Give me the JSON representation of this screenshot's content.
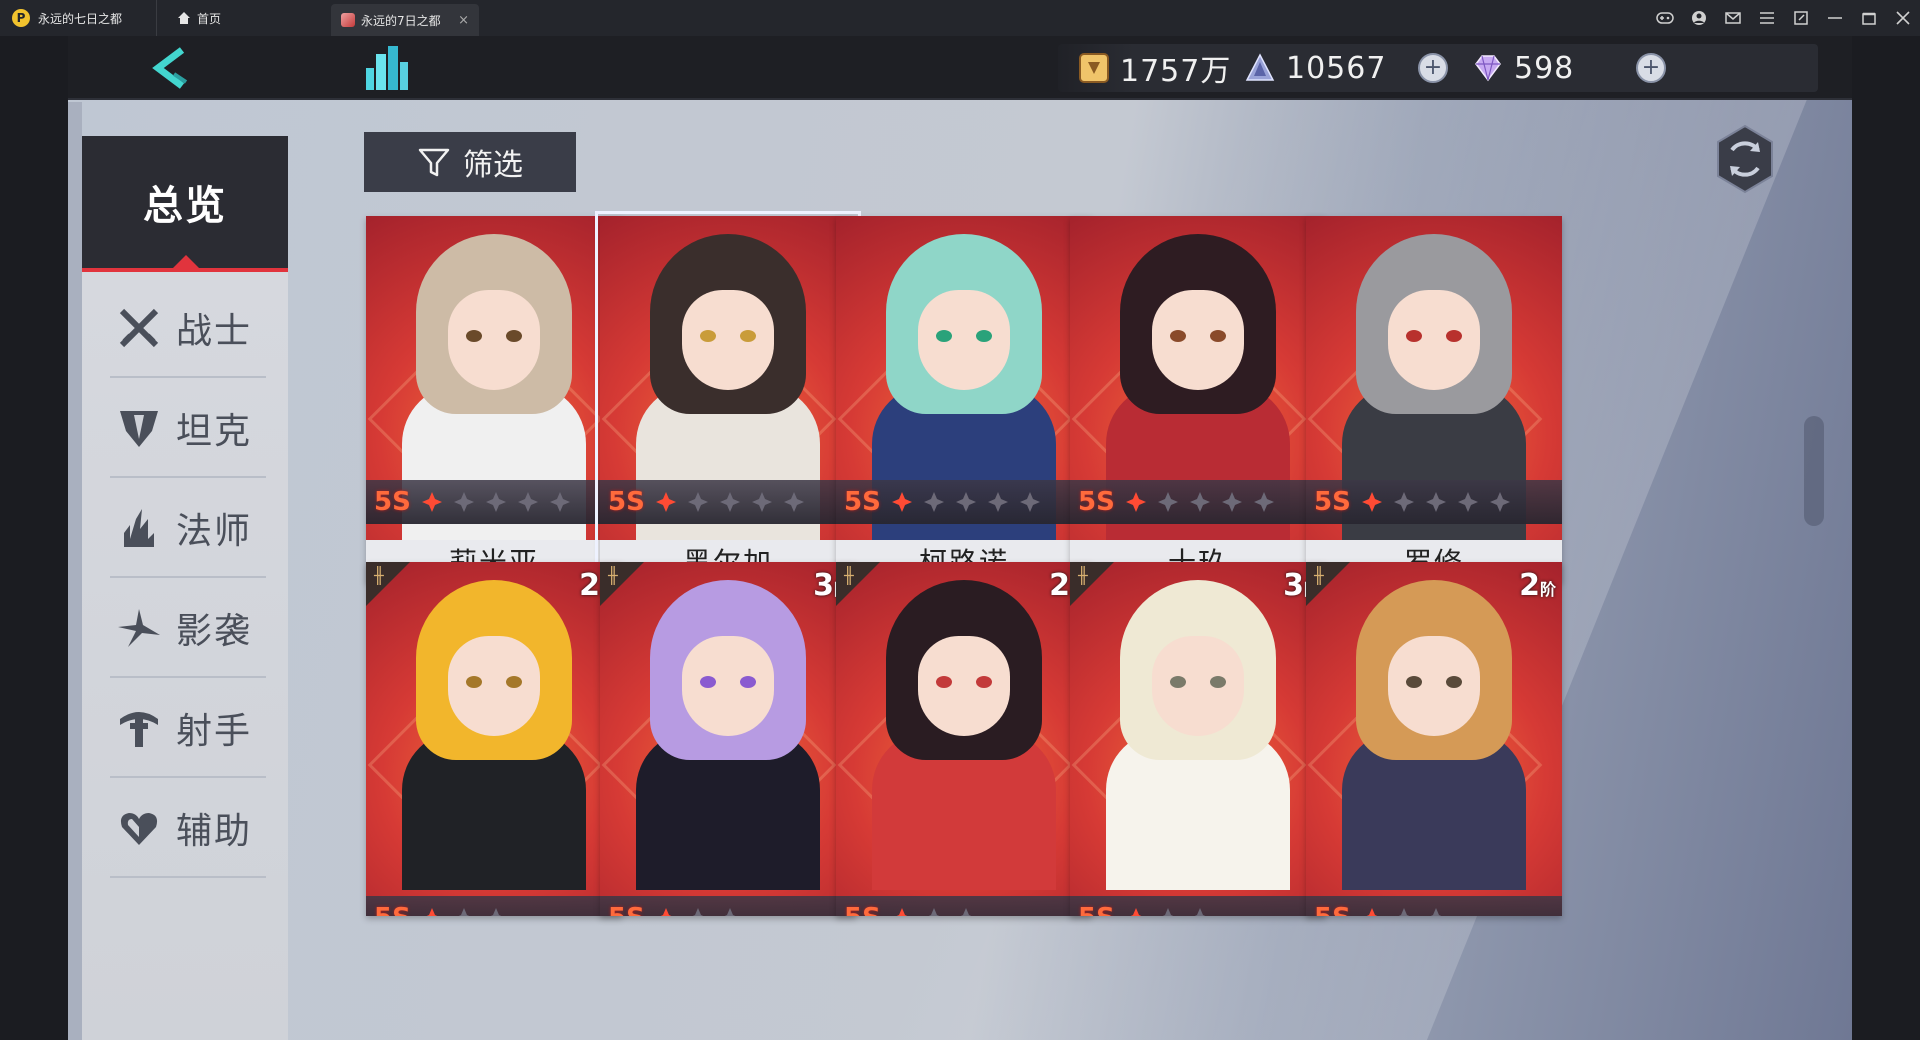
{
  "browser": {
    "app_title": "永远的七日之都",
    "home_tab": "首页",
    "game_tab": "永远的7日之都",
    "tab_close": "×"
  },
  "topbar": {
    "gold": "1757万",
    "crystal": "10567",
    "diamond": "598"
  },
  "sidebar": {
    "overview": "总览",
    "items": [
      {
        "label": "战士",
        "icon": "sword-icon"
      },
      {
        "label": "坦克",
        "icon": "shield-icon"
      },
      {
        "label": "法师",
        "icon": "flame-icon"
      },
      {
        "label": "影袭",
        "icon": "shuriken-icon"
      },
      {
        "label": "射手",
        "icon": "crossbow-icon"
      },
      {
        "label": "辅助",
        "icon": "heart-icon"
      }
    ]
  },
  "filter": {
    "label": "筛选"
  },
  "cards_row1": [
    {
      "name": "莉米亚",
      "rank": "5S",
      "hair": "#cdbba6",
      "body": "#f0f0f0",
      "eye": "#6a4a2a"
    },
    {
      "name": "黑尔加",
      "rank": "5S",
      "hair": "#3a2e2c",
      "body": "#e9e4dd",
      "eye": "#c99c3a"
    },
    {
      "name": "柯路诺",
      "rank": "5S",
      "hair": "#8fd6c8",
      "body": "#2c3f7c",
      "eye": "#2aa27a"
    },
    {
      "name": "十玖",
      "rank": "5S",
      "hair": "#2e1c22",
      "body": "#b92c34",
      "eye": "#8a4a2a"
    },
    {
      "name": "罗修",
      "rank": "5S",
      "hair": "#9a9a9e",
      "body": "#3a3c44",
      "eye": "#b8312d"
    }
  ],
  "cards_row2": [
    {
      "tier": "2",
      "hair": "#f2b62c",
      "body": "#202226",
      "eye": "#a5782a"
    },
    {
      "tier": "3",
      "hair": "#b79be2",
      "body": "#1e1c2a",
      "eye": "#8a5bd0"
    },
    {
      "tier": "2",
      "hair": "#2a1c22",
      "body": "#d23a3a",
      "eye": "#c33a3a"
    },
    {
      "tier": "3",
      "hair": "#efe9d4",
      "body": "#f6f3ec",
      "eye": "#7a7a6a"
    },
    {
      "tier": "2",
      "hair": "#d59a56",
      "body": "#3a3a5a",
      "eye": "#5a4a3a"
    }
  ],
  "tier_suffix": "阶"
}
